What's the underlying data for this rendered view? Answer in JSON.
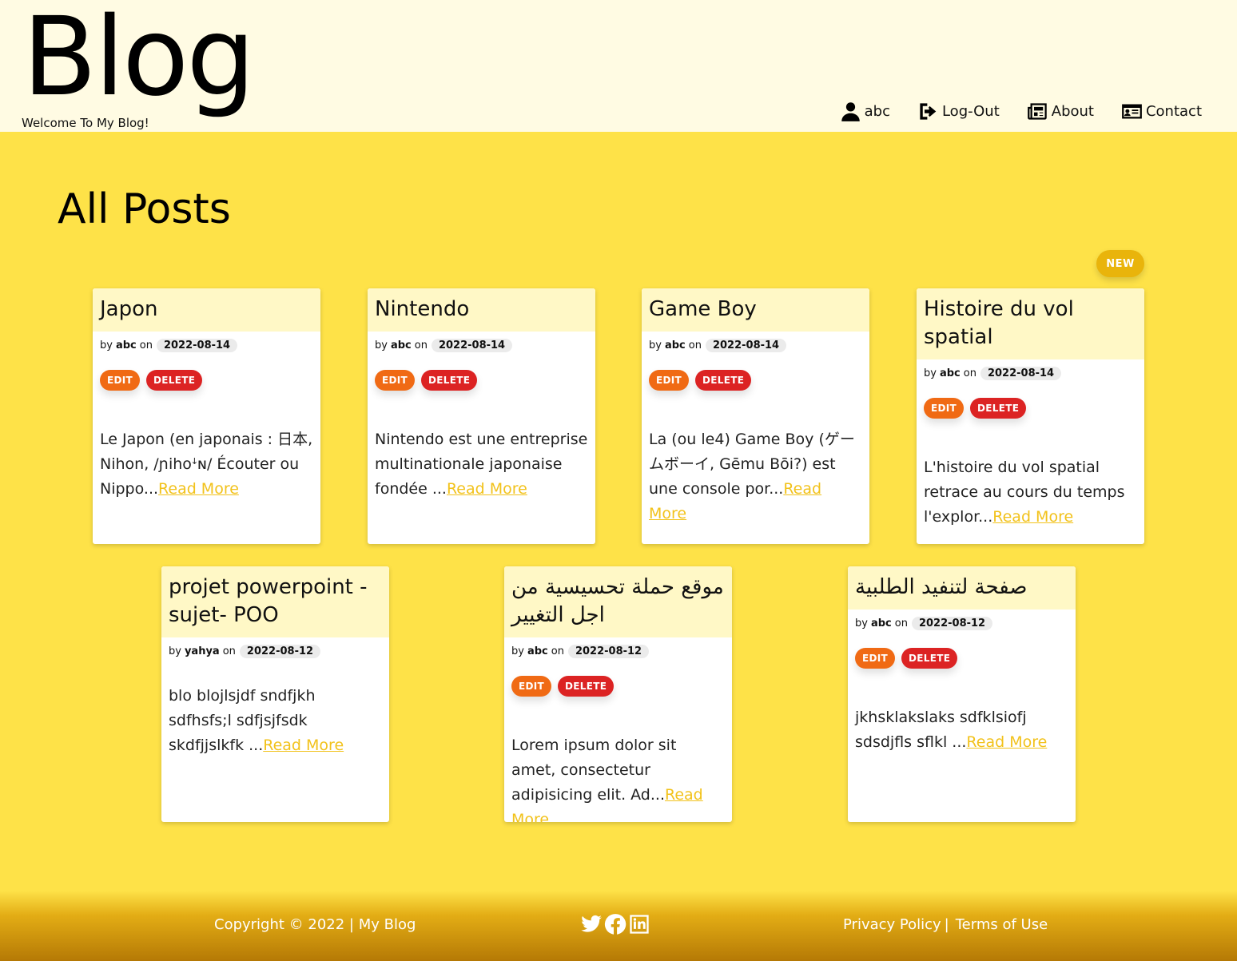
{
  "header": {
    "title": "Blog",
    "tagline": "Welcome To My Blog!",
    "nav": [
      {
        "label": "abc",
        "icon": "user-icon"
      },
      {
        "label": "Log-Out",
        "icon": "logout-icon"
      },
      {
        "label": "About",
        "icon": "newspaper-icon"
      },
      {
        "label": "Contact",
        "icon": "contact-card-icon"
      }
    ]
  },
  "main": {
    "heading": "All Posts",
    "new_badge": "NEW",
    "by_label": "by",
    "on_label": "on",
    "edit_label": "EDIT",
    "delete_label": "DELETE",
    "read_more_label": "Read More",
    "posts": [
      {
        "title": "Japon",
        "author": "abc",
        "date": "2022-08-14",
        "excerpt": "Le Japon (en japonais : 日本, Nihon, /ɲihoꜜɴ/ Écouter ou Nippo...",
        "editable": true
      },
      {
        "title": "Nintendo",
        "author": "abc",
        "date": "2022-08-14",
        "excerpt": "Nintendo est une entreprise multinationale japonaise fondée ...",
        "editable": true
      },
      {
        "title": "Game Boy",
        "author": "abc",
        "date": "2022-08-14",
        "excerpt": "La (ou le4) Game Boy (ゲームボーイ, Gēmu Bōi?) est une console por...",
        "editable": true
      },
      {
        "title": "Histoire du vol spatial",
        "author": "abc",
        "date": "2022-08-14",
        "excerpt": "L'histoire du vol spatial retrace au cours du temps l'explor...",
        "editable": true
      },
      {
        "title": "projet powerpoint - sujet- POO",
        "author": "yahya",
        "date": "2022-08-12",
        "excerpt": "blo blojlsjdf sndfjkh sdfhsfs;l sdfjsjfsdk skdfjjslkfk ...",
        "editable": false
      },
      {
        "title": "موقع حملة تحسيسية من اجل التغيير",
        "author": "abc",
        "date": "2022-08-12",
        "excerpt": "Lorem ipsum dolor sit amet, consectetur adipisicing elit. Ad...",
        "editable": true
      },
      {
        "title": "صفحة لتنفيد الطلبية",
        "author": "abc",
        "date": "2022-08-12",
        "excerpt": "jkhsklakslaks sdfklsiofj sdsdjfls sflkl ...",
        "editable": true
      }
    ]
  },
  "footer": {
    "copyright": "Copyright © 2022 | My Blog",
    "social": [
      "twitter-icon",
      "facebook-icon",
      "linkedin-icon"
    ],
    "privacy": "Privacy Policy",
    "separator": "|",
    "terms": "Terms of Use"
  },
  "colors": {
    "page_bg": "#fee248",
    "header_bg": "#fffbe3",
    "card_head_bg": "#fff8c6",
    "edit": "#f06a14",
    "delete": "#dc2323",
    "badge": "#e9b40b",
    "link": "#f2c21b"
  }
}
